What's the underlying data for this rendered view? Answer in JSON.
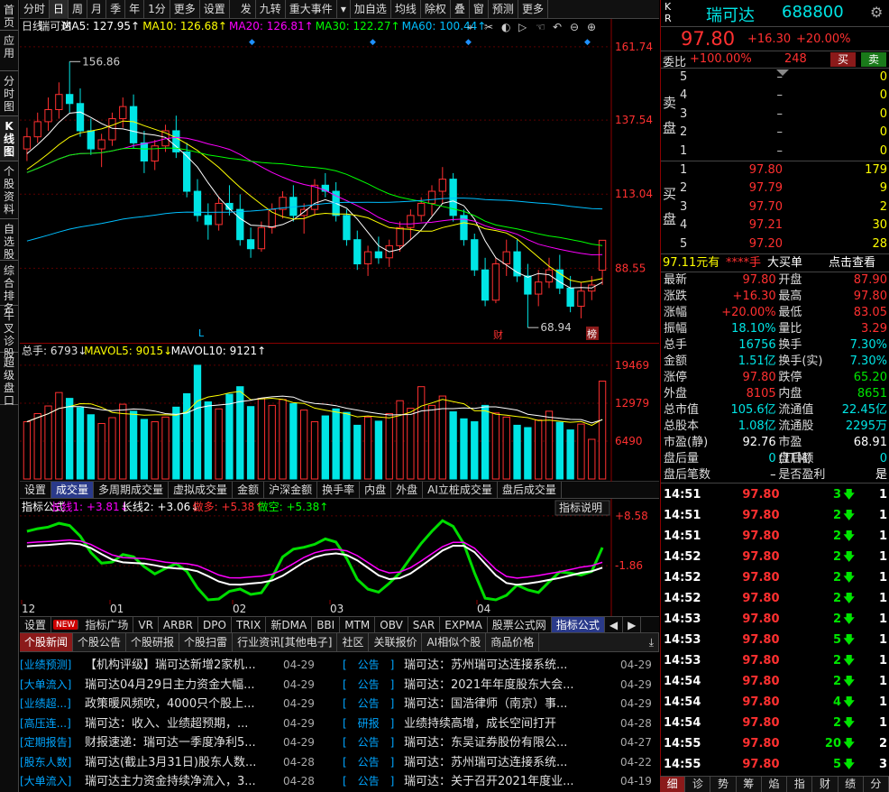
{
  "leftnav": [
    "首页",
    "应用",
    "分时图",
    "K线图",
    "个股资料",
    "自选股",
    "综合排名",
    "牛叉诊股",
    "超级盘口"
  ],
  "leftnav_active": 3,
  "topbar": [
    "分时",
    "日",
    "周",
    "月",
    "季",
    "年",
    "1分",
    "更多",
    "设置",
    "发",
    "九转",
    "重大事件",
    "加自选",
    "均线",
    "除权",
    "叠",
    "窗",
    "预测",
    "更多"
  ],
  "topbar_active": 1,
  "main": {
    "legend": [
      {
        "t": "日线",
        "c": "#e0e0e0"
      },
      {
        "t": "瑞可达",
        "c": "#e0e0e0"
      },
      {
        "t": "MA5: 127.95↑",
        "c": "#ffffff"
      },
      {
        "t": "MA10: 126.68↑",
        "c": "#ffff00"
      },
      {
        "t": "MA20: 126.81↑",
        "c": "#ff00ff"
      },
      {
        "t": "MA30: 122.27↑",
        "c": "#00ff00"
      },
      {
        "t": "MA60: 100.44↑",
        "c": "#00bfff"
      }
    ],
    "price_labels": [
      "161.74",
      "137.54",
      "113.04",
      "88.55"
    ],
    "high_label": "156.86",
    "low_label": "68.94",
    "marker_L": "L",
    "marker_cai": "财",
    "marker_bang": "榜"
  },
  "vol": {
    "legend": [
      {
        "t": "总手: 6793↓",
        "c": "#e0e0e0"
      },
      {
        "t": "MAVOL5: 9015↓",
        "c": "#ffff00"
      },
      {
        "t": "MAVOL10: 9121↑",
        "c": "#ffffff"
      }
    ],
    "labels": [
      "19469",
      "12979",
      "6490"
    ]
  },
  "voltabs": [
    "设置",
    "成交量",
    "多周期成交量",
    "虚拟成交量",
    "金额",
    "沪深金额",
    "换手率",
    "内盘",
    "外盘",
    "AI立桩成交量",
    "盘后成交量"
  ],
  "voltabs_active": 1,
  "ind": {
    "legend": [
      {
        "t": "指标公式",
        "c": "#ffffff"
      },
      {
        "t": "长线1: +3.81↓",
        "c": "#ff00ff"
      },
      {
        "t": "长线2: +3.06↓",
        "c": "#ffffff"
      },
      {
        "t": "做多: +5.38↑",
        "c": "#ff3030"
      },
      {
        "t": "做空: +5.38↑",
        "c": "#00ff00"
      }
    ],
    "help": "指标说明",
    "labels": [
      "+8.58",
      "-1.86"
    ],
    "months": [
      "12",
      "01",
      "02",
      "03",
      "04"
    ]
  },
  "indtabs": [
    "设置",
    "NEW",
    "指标广场",
    "VR",
    "ARBR",
    "DPO",
    "TRIX",
    "新DMA",
    "BBI",
    "MTM",
    "OBV",
    "SAR",
    "EXPMA",
    "股票公式网",
    "指标公式"
  ],
  "indtabs_active": 14,
  "newstabs": [
    "个股新闻",
    "个股公告",
    "个股研报",
    "个股扫雷",
    "行业资讯[其他电子]",
    "社区",
    "关联报价",
    "AI相似个股",
    "商品价格"
  ],
  "newstabs_active": 0,
  "news_left": [
    {
      "cat": "[业绩预测]",
      "txt": "【机构评级】瑞可达新增2家机...",
      "date": "04-29"
    },
    {
      "cat": "[大单流入]",
      "txt": "瑞可达04月29日主力资金大幅...",
      "date": "04-29"
    },
    {
      "cat": "[业绩超...]",
      "txt": "政策暖风频吹，4000只个股上...",
      "date": "04-29"
    },
    {
      "cat": "[高压连...]",
      "txt": "瑞可达：收入、业绩超预期，...",
      "date": "04-29"
    },
    {
      "cat": "[定期报告]",
      "txt": "财报速递：瑞可达一季度净利5...",
      "date": "04-29"
    },
    {
      "cat": "[股东人数]",
      "txt": "瑞可达(截止3月31日)股东人数...",
      "date": "04-28"
    },
    {
      "cat": "[大单流入]",
      "txt": "瑞可达主力资金持续净流入，3...",
      "date": "04-28"
    }
  ],
  "news_right": [
    {
      "cat": "[　公告　]",
      "txt": "瑞可达：苏州瑞可达连接系统...",
      "date": "04-29"
    },
    {
      "cat": "[　公告　]",
      "txt": "瑞可达：2021年年度股东大会...",
      "date": "04-29"
    },
    {
      "cat": "[　公告　]",
      "txt": "瑞可达：国浩律师（南京）事...",
      "date": "04-29"
    },
    {
      "cat": "[　研报　]",
      "txt": "业绩持续高增，成长空间打开",
      "date": "04-28"
    },
    {
      "cat": "[　公告　]",
      "txt": "瑞可达：东吴证券股份有限公...",
      "date": "04-27"
    },
    {
      "cat": "[　公告　]",
      "txt": "瑞可达：苏州瑞可达连接系统...",
      "date": "04-22"
    },
    {
      "cat": "[　公告　]",
      "txt": "瑞可达：关于召开2021年度业...",
      "date": "04-19"
    }
  ],
  "quote": {
    "board": "K",
    "board2": "R",
    "name": "瑞可达",
    "code": "688800",
    "price": "97.80",
    "change": "+16.30",
    "pct": "+20.00%",
    "weibi_label": "委比",
    "weibi": "+100.00%",
    "weicha": "248",
    "buy": "买",
    "sell": "卖",
    "sell_side_label": [
      "卖",
      "盘"
    ],
    "buy_side_label": [
      "买",
      "盘"
    ],
    "asks": [
      {
        "n": "5",
        "p": "–",
        "v": "0"
      },
      {
        "n": "4",
        "p": "–",
        "v": "0"
      },
      {
        "n": "3",
        "p": "–",
        "v": "0"
      },
      {
        "n": "2",
        "p": "–",
        "v": "0"
      },
      {
        "n": "1",
        "p": "–",
        "v": "0"
      }
    ],
    "bids": [
      {
        "n": "1",
        "p": "97.80",
        "v": "179"
      },
      {
        "n": "2",
        "p": "97.79",
        "v": "9"
      },
      {
        "n": "3",
        "p": "97.70",
        "v": "2"
      },
      {
        "n": "4",
        "p": "97.21",
        "v": "30"
      },
      {
        "n": "5",
        "p": "97.20",
        "v": "28"
      }
    ],
    "bigorder": {
      "a": "97.11元有",
      "b": "****手",
      "c": "大买单",
      "d": "点击查看"
    },
    "stats": [
      {
        "l1": "最新",
        "v1": "97.80",
        "c1": "red",
        "l2": "开盘",
        "v2": "87.90",
        "c2": "red"
      },
      {
        "l1": "涨跌",
        "v1": "+16.30",
        "c1": "red",
        "l2": "最高",
        "v2": "97.80",
        "c2": "red"
      },
      {
        "l1": "涨幅",
        "v1": "+20.00%",
        "c1": "red",
        "l2": "最低",
        "v2": "83.05",
        "c2": "red"
      },
      {
        "l1": "振幅",
        "v1": "18.10%",
        "c1": "cyan",
        "l2": "量比",
        "v2": "3.29",
        "c2": "red"
      },
      {
        "l1": "总手",
        "v1": "16756",
        "c1": "cyan",
        "l2": "换手",
        "v2": "7.30%",
        "c2": "cyan"
      },
      {
        "l1": "金额",
        "v1": "1.51亿",
        "c1": "cyan",
        "l2": "换手(实)",
        "v2": "7.30%",
        "c2": "cyan"
      },
      {
        "l1": "涨停",
        "v1": "97.80",
        "c1": "red",
        "l2": "跌停",
        "v2": "65.20",
        "c2": "green"
      },
      {
        "l1": "外盘",
        "v1": "8105",
        "c1": "red",
        "l2": "内盘",
        "v2": "8651",
        "c2": "green"
      },
      {
        "l1": "总市值",
        "v1": "105.6亿",
        "c1": "cyan",
        "l2": "流通值",
        "v2": "22.45亿",
        "c2": "cyan"
      },
      {
        "l1": "总股本",
        "v1": "1.08亿",
        "c1": "cyan",
        "l2": "流通股",
        "v2": "2295万",
        "c2": "cyan"
      },
      {
        "l1": "市盈(静)",
        "v1": "92.76",
        "c1": "white",
        "l2": "市盈(TTM)",
        "v2": "68.91",
        "c2": "white"
      },
      {
        "l1": "盘后量",
        "v1": "0",
        "c1": "cyan",
        "l2": "盘后额",
        "v2": "0",
        "c2": "cyan"
      },
      {
        "l1": "盘后笔数",
        "v1": "–",
        "c1": "white",
        "l2": "是否盈利",
        "v2": "是",
        "c2": "white"
      }
    ],
    "ticks": [
      {
        "t": "14:51",
        "p": "97.80",
        "v": "3",
        "n": "1"
      },
      {
        "t": "14:51",
        "p": "97.80",
        "v": "2",
        "n": "1"
      },
      {
        "t": "14:51",
        "p": "97.80",
        "v": "2",
        "n": "1"
      },
      {
        "t": "14:52",
        "p": "97.80",
        "v": "2",
        "n": "1"
      },
      {
        "t": "14:52",
        "p": "97.80",
        "v": "2",
        "n": "1"
      },
      {
        "t": "14:52",
        "p": "97.80",
        "v": "2",
        "n": "1"
      },
      {
        "t": "14:53",
        "p": "97.80",
        "v": "2",
        "n": "1"
      },
      {
        "t": "14:53",
        "p": "97.80",
        "v": "5",
        "n": "1"
      },
      {
        "t": "14:53",
        "p": "97.80",
        "v": "2",
        "n": "1"
      },
      {
        "t": "14:54",
        "p": "97.80",
        "v": "2",
        "n": "1"
      },
      {
        "t": "14:54",
        "p": "97.80",
        "v": "4",
        "n": "1"
      },
      {
        "t": "14:54",
        "p": "97.80",
        "v": "2",
        "n": "1"
      },
      {
        "t": "14:55",
        "p": "97.80",
        "v": "20",
        "n": "2"
      },
      {
        "t": "14:55",
        "p": "97.80",
        "v": "5",
        "n": "3"
      }
    ]
  },
  "bottomtabs": [
    "细",
    "诊",
    "势",
    "筹",
    "焰",
    "指",
    "财",
    "绩",
    "分"
  ],
  "bottomtabs_active": 0,
  "chart_data": {
    "type": "candlestick",
    "title": "瑞可达 日线",
    "ylim": [
      68.94,
      161.74
    ],
    "y_ticks": [
      161.74,
      137.54,
      113.04,
      88.55
    ],
    "high": 156.86,
    "low": 68.94,
    "last": 97.8,
    "candles": [
      [
        128,
        135,
        124,
        132
      ],
      [
        132,
        140,
        130,
        137
      ],
      [
        137,
        145,
        134,
        141
      ],
      [
        141,
        150,
        138,
        146
      ],
      [
        146,
        156.86,
        140,
        143
      ],
      [
        143,
        148,
        132,
        134
      ],
      [
        134,
        138,
        126,
        128
      ],
      [
        128,
        133,
        122,
        131
      ],
      [
        131,
        140,
        129,
        138
      ],
      [
        138,
        145,
        135,
        142
      ],
      [
        142,
        146,
        128,
        130
      ],
      [
        130,
        134,
        120,
        124
      ],
      [
        124,
        131,
        121,
        129
      ],
      [
        129,
        136,
        127,
        134
      ],
      [
        134,
        139,
        125,
        127
      ],
      [
        127,
        130,
        112,
        114
      ],
      [
        114,
        118,
        104,
        106
      ],
      [
        106,
        110,
        98,
        103
      ],
      [
        103,
        112,
        101,
        110
      ],
      [
        110,
        116,
        106,
        108
      ],
      [
        108,
        113,
        96,
        98
      ],
      [
        98,
        102,
        92,
        95
      ],
      [
        95,
        104,
        94,
        102
      ],
      [
        102,
        110,
        100,
        108
      ],
      [
        108,
        114,
        105,
        112
      ],
      [
        112,
        116,
        104,
        106
      ],
      [
        106,
        110,
        100,
        108
      ],
      [
        108,
        118,
        106,
        116
      ],
      [
        116,
        120,
        112,
        114
      ],
      [
        114,
        117,
        104,
        106
      ],
      [
        106,
        108,
        96,
        98
      ],
      [
        98,
        101,
        88,
        90
      ],
      [
        90,
        96,
        86,
        94
      ],
      [
        94,
        99,
        90,
        92
      ],
      [
        92,
        98,
        89,
        96
      ],
      [
        96,
        104,
        94,
        102
      ],
      [
        102,
        108,
        98,
        106
      ],
      [
        106,
        112,
        104,
        110
      ],
      [
        110,
        116,
        106,
        114
      ],
      [
        114,
        122,
        110,
        118
      ],
      [
        118,
        120,
        104,
        106
      ],
      [
        106,
        108,
        96,
        98
      ],
      [
        98,
        100,
        86,
        88
      ],
      [
        88,
        92,
        76,
        78
      ],
      [
        78,
        92,
        77,
        90
      ],
      [
        90,
        98,
        86,
        94
      ],
      [
        94,
        98,
        84,
        86
      ],
      [
        86,
        90,
        68.94,
        80
      ],
      [
        80,
        88,
        76,
        84
      ],
      [
        84,
        92,
        82,
        88
      ],
      [
        88,
        93,
        80,
        82
      ],
      [
        82,
        86,
        74,
        76
      ],
      [
        76,
        84,
        72,
        81
      ],
      [
        81,
        86,
        78,
        83
      ],
      [
        87.9,
        97.8,
        83.05,
        97.8
      ]
    ],
    "volume": [
      9800,
      11200,
      12500,
      14800,
      13800,
      12200,
      11000,
      9500,
      10500,
      12800,
      11600,
      10200,
      9800,
      10600,
      12300,
      14600,
      19469,
      13200,
      12000,
      14500,
      15800,
      12400,
      13800,
      12600,
      13600,
      12900,
      11800,
      9800,
      10800,
      12000,
      11400,
      9200,
      10600,
      9900,
      11200,
      13400,
      12100,
      15800,
      12600,
      14200,
      11500,
      10300,
      9800,
      12600,
      11300,
      10600,
      9200,
      8800,
      10100,
      11600,
      9700,
      8400,
      9400,
      6793,
      16756
    ]
  }
}
